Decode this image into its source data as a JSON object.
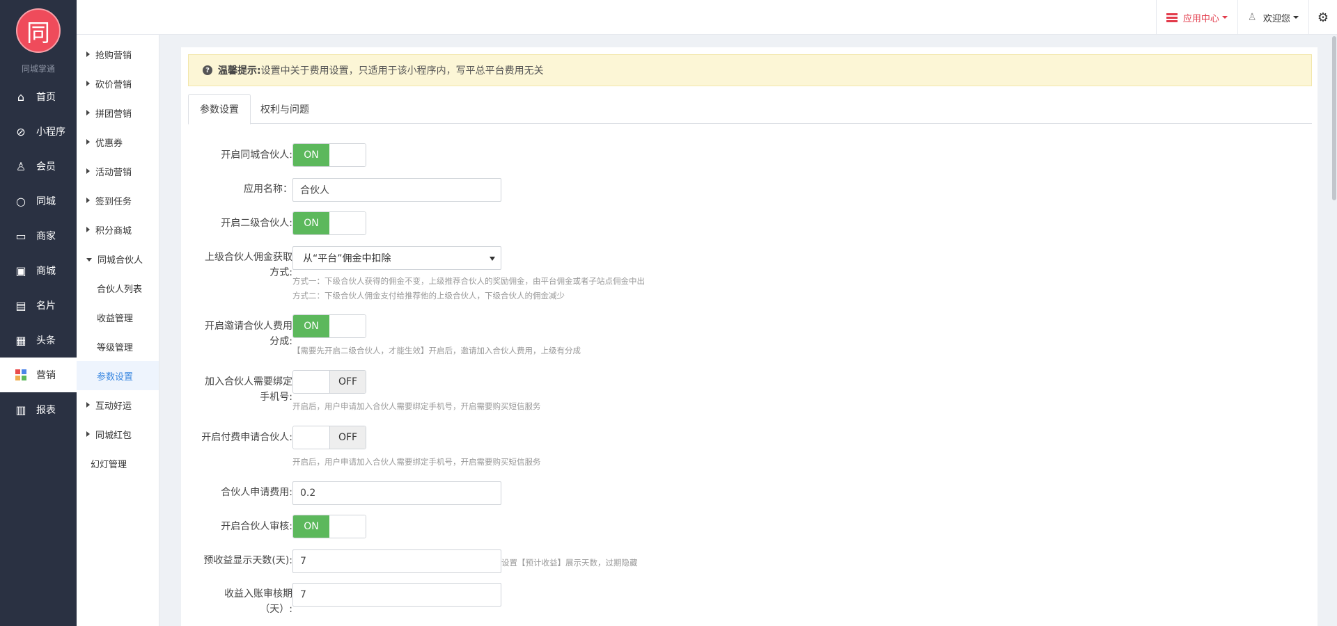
{
  "brand": {
    "logo_char": "同",
    "name": "同城掌通"
  },
  "nav": [
    {
      "label": "首页",
      "icon": "home-icon",
      "glyph": "⌂"
    },
    {
      "label": "小程序",
      "icon": "miniprogram-icon",
      "glyph": "⊘"
    },
    {
      "label": "会员",
      "icon": "user-icon",
      "glyph": "♙"
    },
    {
      "label": "同城",
      "icon": "ring-icon",
      "glyph": "○"
    },
    {
      "label": "商家",
      "icon": "store-icon",
      "glyph": "▭"
    },
    {
      "label": "商城",
      "icon": "shop-bag-icon",
      "glyph": "▣"
    },
    {
      "label": "名片",
      "icon": "card-icon",
      "glyph": "▤"
    },
    {
      "label": "头条",
      "icon": "news-icon",
      "glyph": "▦"
    },
    {
      "label": "营销",
      "icon": "grid-icon",
      "glyph": "▚"
    },
    {
      "label": "报表",
      "icon": "chart-icon",
      "glyph": "▥"
    }
  ],
  "subnav": [
    "抢购营销",
    "砍价营销",
    "拼团营销",
    "优惠券",
    "活动营销",
    "签到任务",
    "积分商城",
    "同城合伙人",
    "合伙人列表",
    "收益管理",
    "等级管理",
    "参数设置",
    "互动好运",
    "同城红包",
    "幻灯管理"
  ],
  "topbar": {
    "app_center": "应用中心",
    "welcome": "欢迎您"
  },
  "notice": {
    "title": "温馨提示:",
    "text": "设置中关于费用设置，只适用于该小程序内，写平总平台费用无关"
  },
  "tabs": [
    "参数设置",
    "权利与问题"
  ],
  "toggles": {
    "on": "ON",
    "off": "OFF"
  },
  "form": {
    "enable_partner": "开启同城合伙人:",
    "app_name_label": "应用名称：",
    "app_name_value": "合伙人",
    "enable_level2": "开启二级合伙人:",
    "commission_label_1": "上级合伙人佣金获取",
    "commission_label_2": "方式:",
    "commission_value": "从“平台”佣金中扣除",
    "commission_help_1": "方式一：下级合伙人获得的佣金不变，上级推荐合伙人的奖励佣金，由平台佣金或者子站点佣金中出",
    "commission_help_2": "方式二：下级合伙人佣金支付给推荐他的上级合伙人，下级合伙人的佣金减少",
    "invite_label_1": "开启邀请合伙人费用",
    "invite_label_2": "分成:",
    "invite_help": "【需要先开启二级合伙人，才能生效】开启后，邀请加入合伙人费用，上级有分成",
    "bind_label_1": "加入合伙人需要绑定",
    "bind_label_2": "手机号:",
    "bind_help": "开启后，用户申请加入合伙人需要绑定手机号，开启需要购买短信服务",
    "paid_label": "开启付费申请合伙人:",
    "paid_help": "开启后，用户申请加入合伙人需要绑定手机号，开启需要购买短信服务",
    "fee_label": "合伙人申请费用:",
    "fee_value": "0.2",
    "audit_label": "开启合伙人审核:",
    "preview_days_label": "预收益显示天数(天):",
    "preview_days_value": "7",
    "preview_days_help": "设置【预计收益】展示天数，过期隐藏",
    "audit_days_label_1": "收益入账审核期",
    "audit_days_label_2": "（天）:",
    "audit_days_value": "7"
  }
}
